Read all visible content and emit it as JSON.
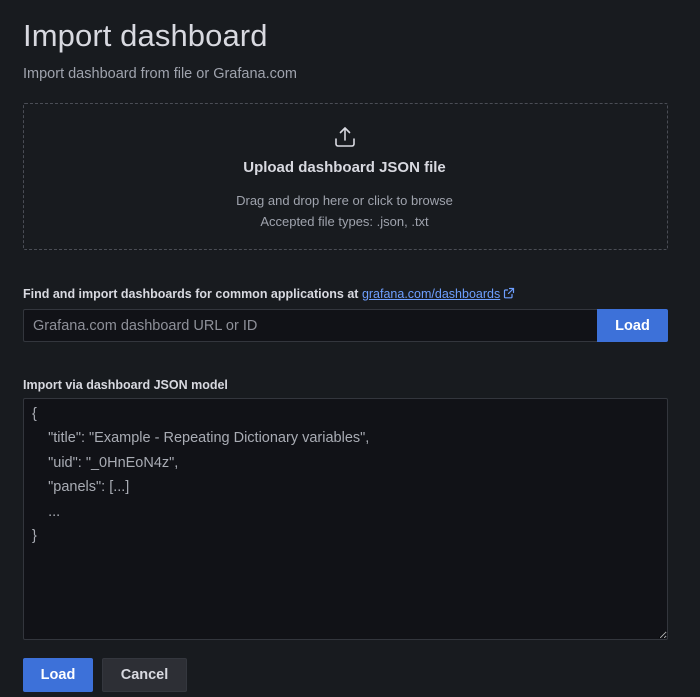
{
  "header": {
    "title": "Import dashboard",
    "subtitle": "Import dashboard from file or Grafana.com"
  },
  "upload": {
    "icon": "upload-icon",
    "title": "Upload dashboard JSON file",
    "hint": "Drag and drop here or click to browse",
    "accepted": "Accepted file types: .json, .txt"
  },
  "grafana_com": {
    "label": "Find and import dashboards for common applications at",
    "link_text": "grafana.com/dashboards",
    "link_icon": "external-link-icon",
    "input_placeholder": "Grafana.com dashboard URL or ID",
    "input_value": "",
    "load_label": "Load"
  },
  "json_model": {
    "label": "Import via dashboard JSON model",
    "placeholder": "{\n    \"title\": \"Example - Repeating Dictionary variables\",\n    \"uid\": \"_0HnEoN4z\",\n    \"panels\": [...]\n    ...\n}",
    "value": ""
  },
  "actions": {
    "load_label": "Load",
    "cancel_label": "Cancel"
  },
  "colors": {
    "background": "#181b1f",
    "primary": "#3d71d9",
    "link": "#6e9fff"
  }
}
